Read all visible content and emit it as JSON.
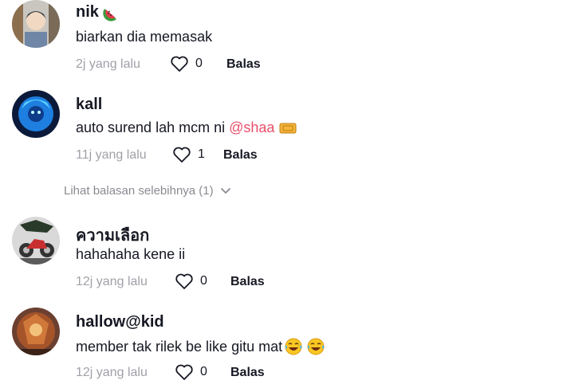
{
  "comments": [
    {
      "username": "nik",
      "username_emoji": "watermelon-icon",
      "text": "biarkan dia memasak",
      "time": "2j yang lalu",
      "likes": "0",
      "reply_label": "Balas"
    },
    {
      "username": "kall",
      "text": "auto surend lah mcm ni",
      "mention": "@shaa",
      "text_emoji": "ticket-icon",
      "time": "11j yang lalu",
      "likes": "1",
      "reply_label": "Balas"
    },
    {
      "username": "ความเลือก",
      "text": "hahahaha kene ii",
      "time": "12j yang lalu",
      "likes": "0",
      "reply_label": "Balas"
    },
    {
      "username": "hallow@kid",
      "text": "member tak rilek be like gitu mat",
      "text_emoji": "laughing-tears-icon",
      "time": "12j yang lalu",
      "likes": "0",
      "reply_label": "Balas"
    }
  ],
  "more_replies": {
    "label": "Lihat balasan selebihnya (1)",
    "icon": "chevron-down-icon"
  },
  "colors": {
    "text": "#161823",
    "muted": "#a0a0a8",
    "mention": "#e8506a"
  }
}
